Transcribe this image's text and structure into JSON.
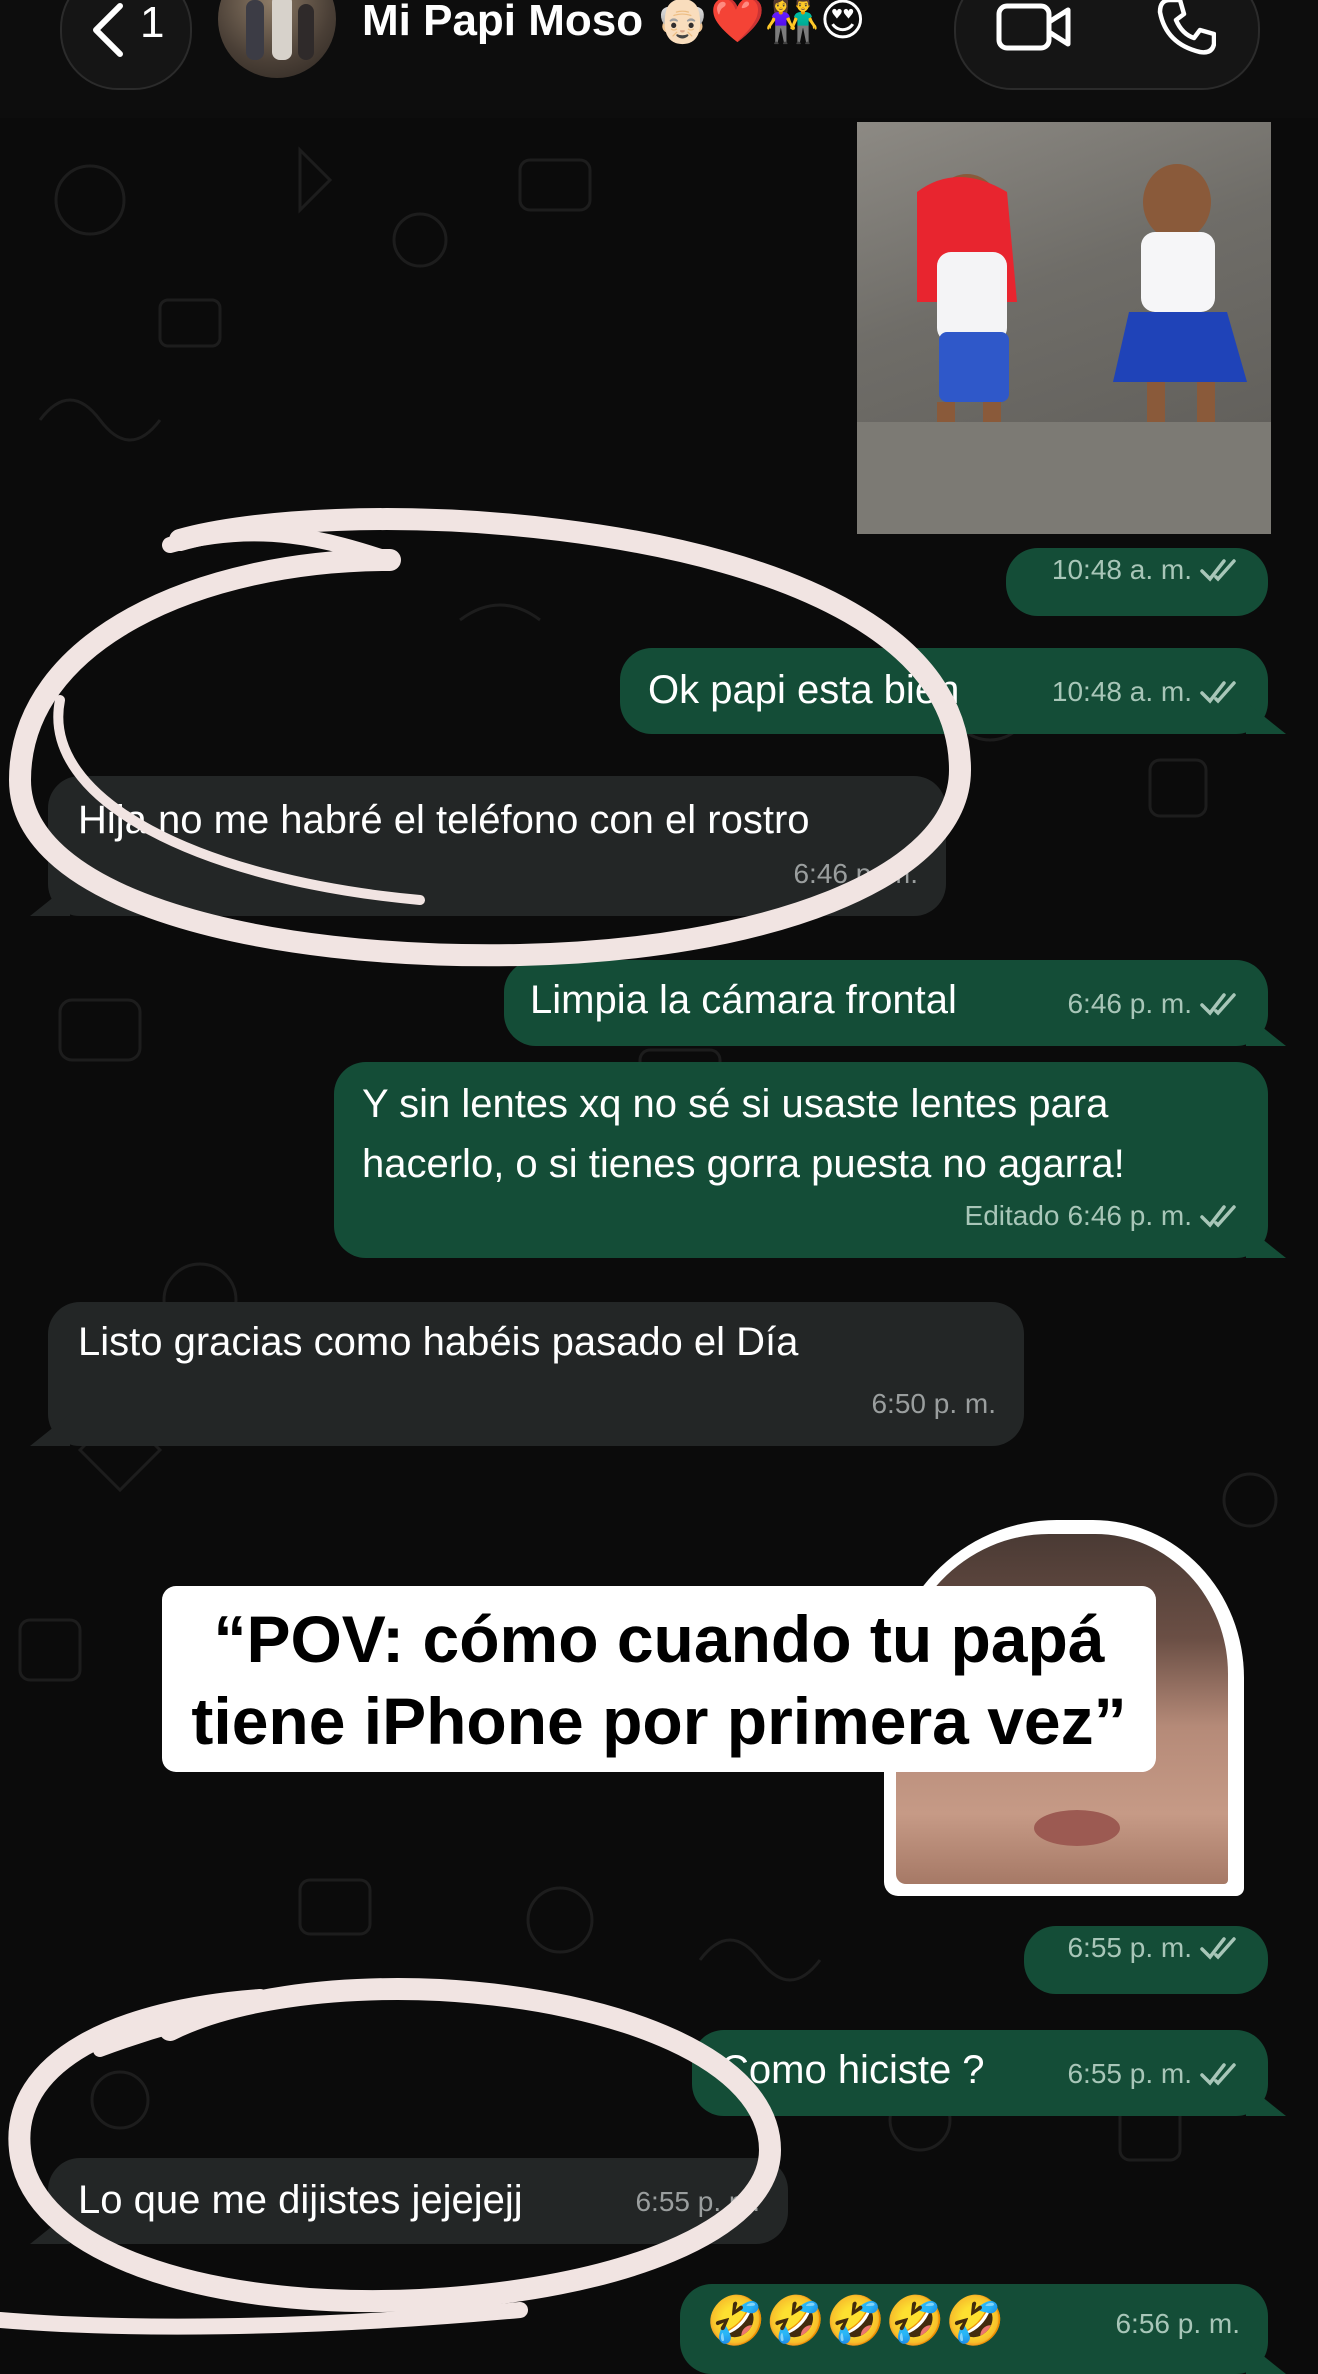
{
  "header": {
    "back_count": "1",
    "contact_name": "Mi Papi Moso 👴🏻❤️👫😍"
  },
  "messages": [
    {
      "dir": "out",
      "type": "gif",
      "time": "10:48 a. m."
    },
    {
      "dir": "out",
      "text": "Ok papi esta bien",
      "time": "10:48 a. m."
    },
    {
      "dir": "in",
      "text": "Hija no me habré el teléfono con el rostro",
      "time": "6:46 p. m."
    },
    {
      "dir": "out",
      "text": "Limpia la cámara frontal",
      "time": "6:46 p. m."
    },
    {
      "dir": "out",
      "text": "Y sin lentes xq no sé si usaste lentes para hacerlo, o si tienes gorra puesta no agarra!",
      "time": "6:46 p. m.",
      "edited_label": "Editado"
    },
    {
      "dir": "in",
      "text": "Listo gracias como habéis pasado el Día",
      "time": "6:50 p. m."
    },
    {
      "dir": "out",
      "type": "sticker",
      "time": "6:55 p. m."
    },
    {
      "dir": "out",
      "text": "Como hiciste ?",
      "time": "6:55 p. m."
    },
    {
      "dir": "in",
      "text": "Lo que me dijistes jejejejj",
      "time": "6:55 p. m."
    },
    {
      "dir": "out",
      "text": "🤣🤣🤣🤣🤣",
      "time": "6:56 p. m."
    }
  ],
  "overlay": {
    "caption_line1": "“POV: cómo cuando tu papá",
    "caption_line2": "tiene iPhone por primera vez”"
  },
  "colors": {
    "outgoing_bubble": "#144d37",
    "incoming_bubble": "#232626",
    "background": "#0b0b0b",
    "scribble": "#f1e4e2"
  },
  "icons": {
    "back": "chevron-left-icon",
    "video": "video-camera-icon",
    "phone": "phone-icon",
    "read_receipt": "double-check-icon"
  }
}
